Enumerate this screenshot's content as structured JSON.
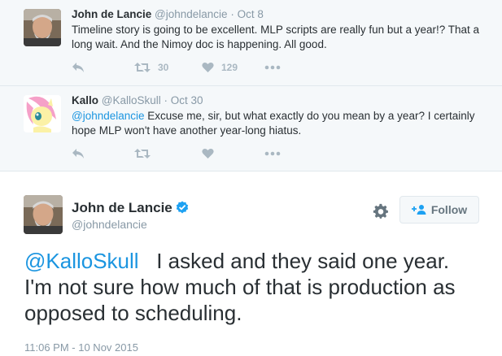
{
  "thread": {
    "tweets": [
      {
        "fullname": "John de Lancie",
        "handle": "@johndelancie",
        "date": "Oct 8",
        "text": "Timeline story is going to be excellent. MLP scripts are really fun but a year!? That a long wait. And the Nimoy doc is happening. All good.",
        "retweets": "30",
        "likes": "129",
        "avatar": "photo-avatar"
      },
      {
        "fullname": "Kallo",
        "handle": "@KalloSkull",
        "date": "Oct 30",
        "mention": "@johndelancie",
        "text": " Excuse me, sir, but what exactly do you mean by a year? I certainly hope MLP won't have another year-long hiatus.",
        "avatar": "pony-avatar"
      }
    ]
  },
  "main": {
    "fullname": "John de Lancie",
    "handle": "@johndelancie",
    "follow_label": "Follow",
    "mention": "@KalloSkull",
    "text": "   I asked and they said one year. I'm not sure how much of that is production as opposed to scheduling.",
    "timestamp": "11:06 PM - 10 Nov 2015"
  },
  "colors": {
    "link": "#1b95e0",
    "verified": "#1da1f2",
    "icon_muted": "#aab8c2",
    "thread_bg": "#f5f8fa"
  },
  "icons": [
    "reply-icon",
    "retweet-icon",
    "heart-icon",
    "more-icon",
    "verified-badge-icon",
    "gear-icon",
    "add-user-icon"
  ]
}
